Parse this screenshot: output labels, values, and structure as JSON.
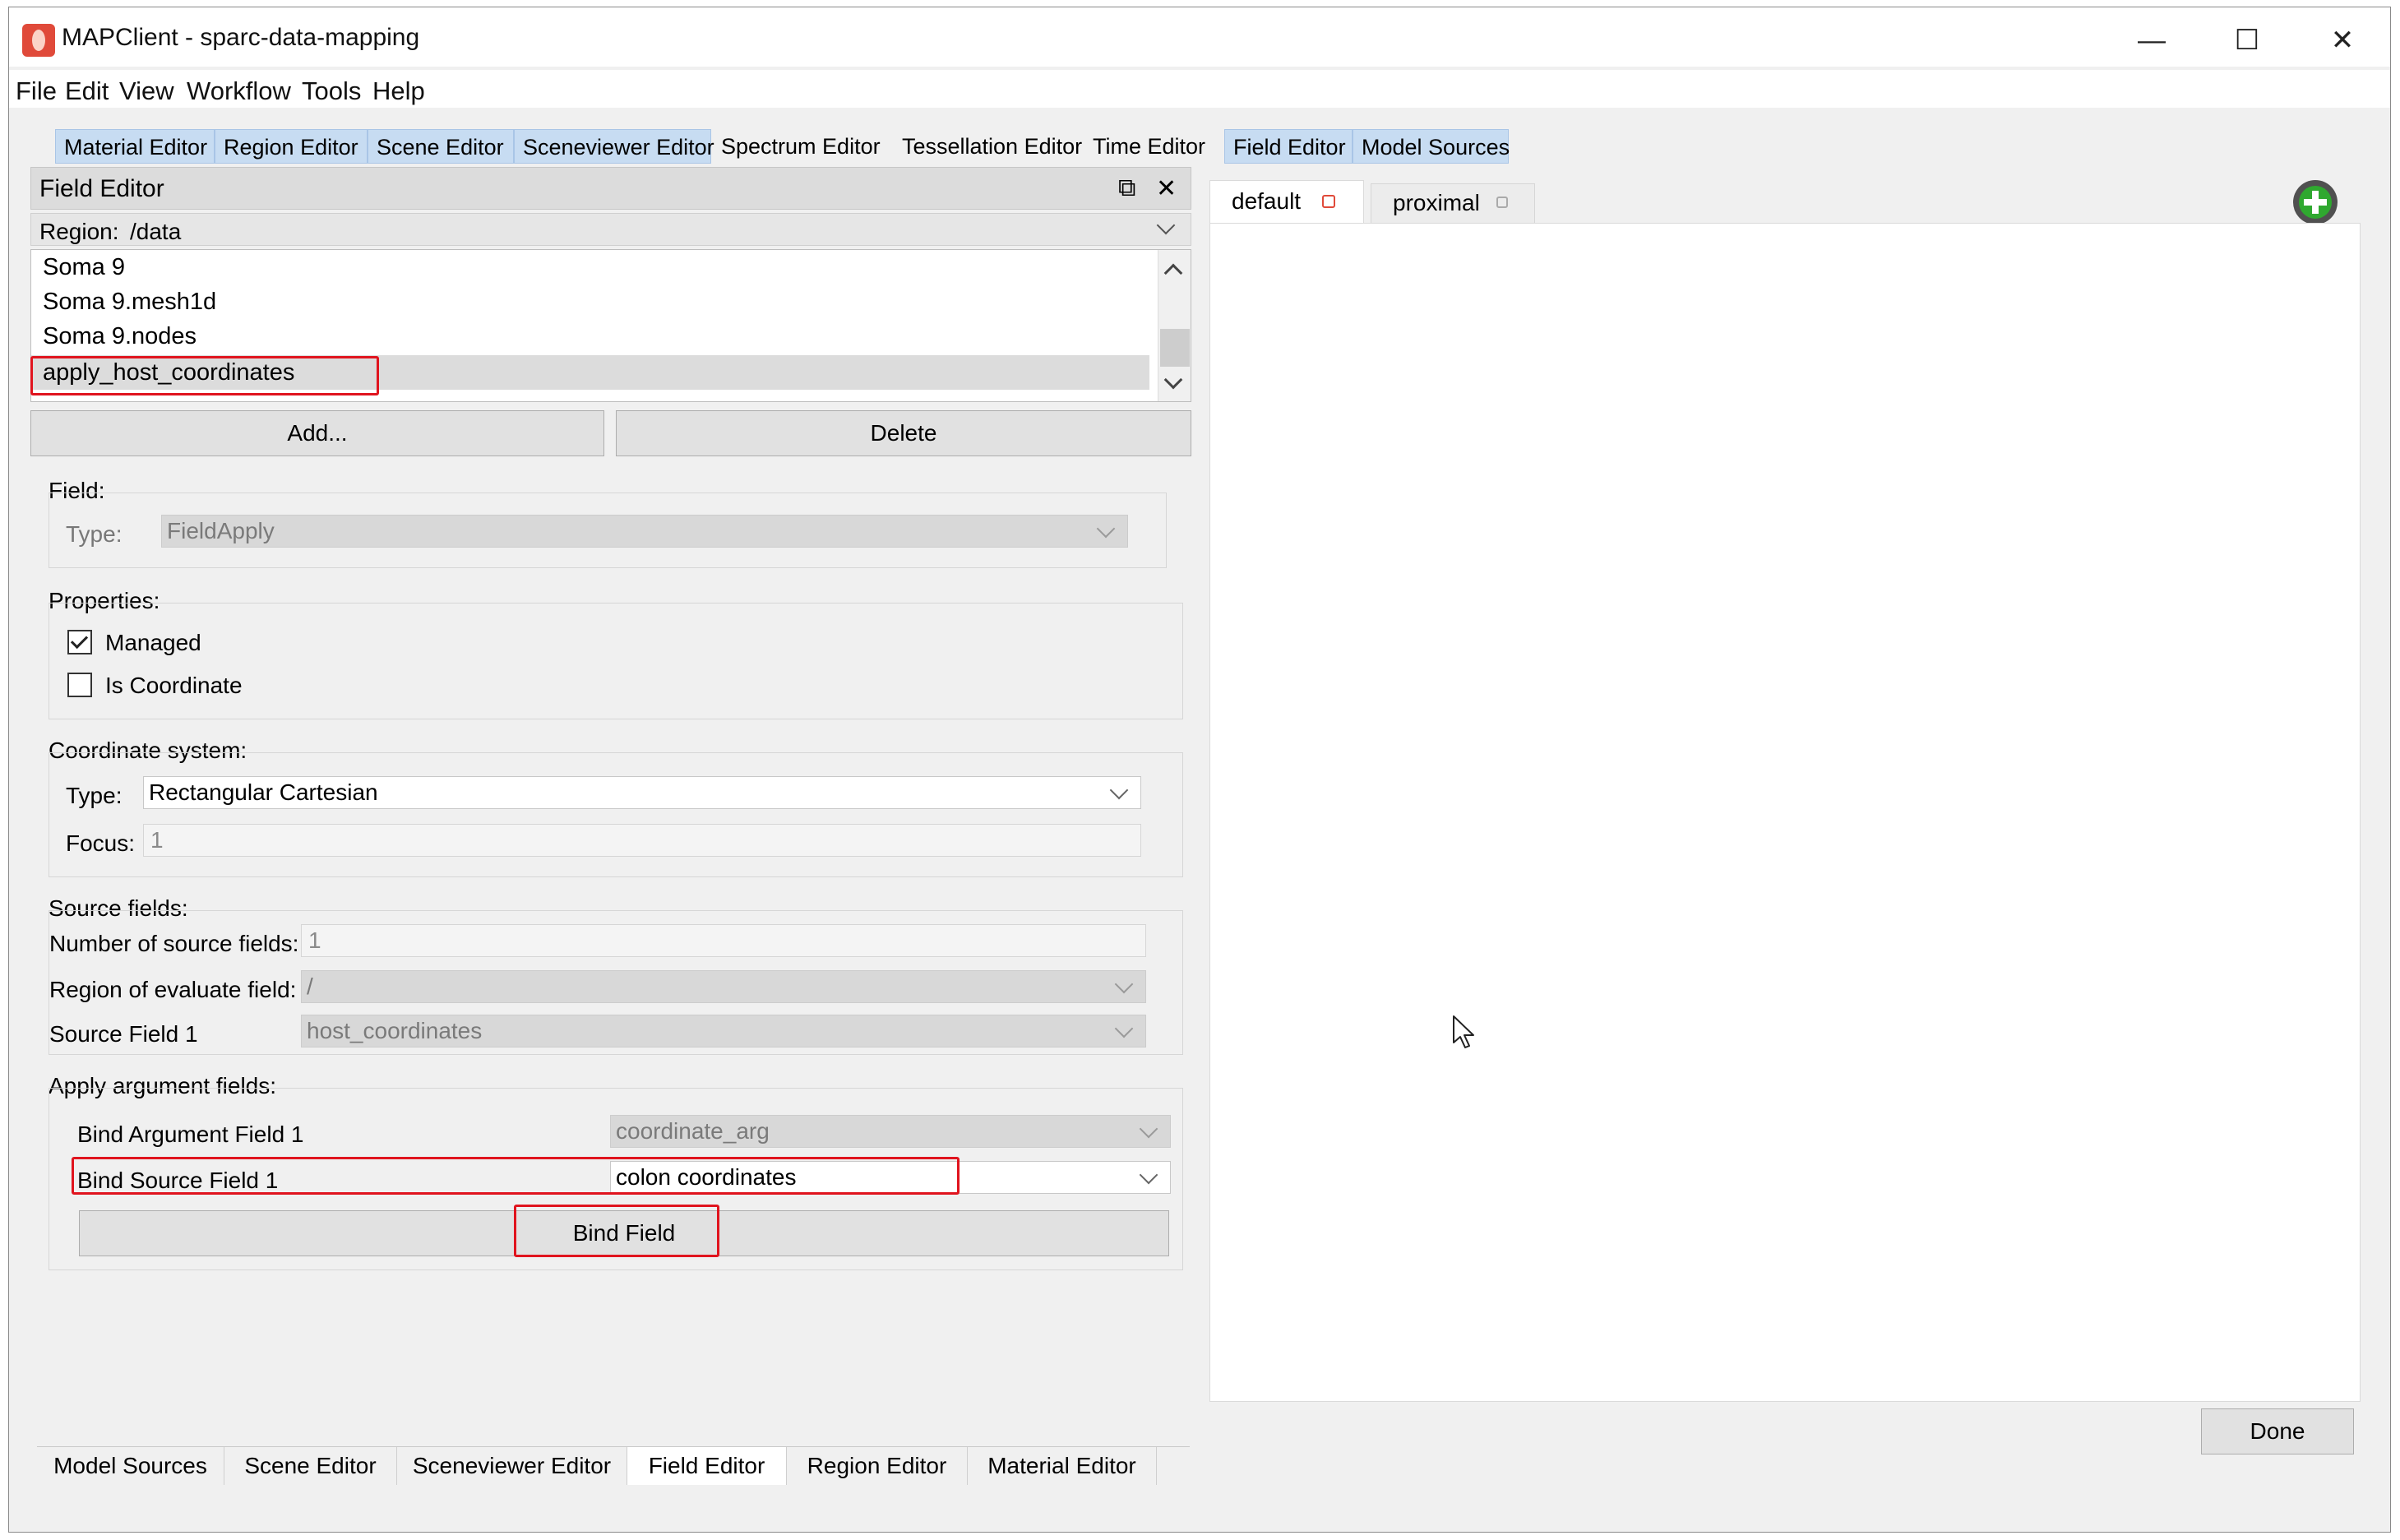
{
  "window": {
    "title": "MAPClient - sparc-data-mapping",
    "minimize_glyph": "—",
    "maximize_glyph": "☐",
    "close_glyph": "✕"
  },
  "menu": [
    "File",
    "Edit",
    "View",
    "Workflow",
    "Tools",
    "Help"
  ],
  "top_tabs": [
    {
      "label": "Material Editor",
      "highlighted": true
    },
    {
      "label": "Region Editor",
      "highlighted": true
    },
    {
      "label": "Scene Editor",
      "highlighted": true
    },
    {
      "label": "Sceneviewer Editor",
      "highlighted": true
    },
    {
      "label": "Spectrum Editor",
      "highlighted": false
    },
    {
      "label": "Tessellation Editor",
      "highlighted": false
    },
    {
      "label": "Time Editor",
      "highlighted": false
    },
    {
      "label": "Field Editor",
      "highlighted": true
    },
    {
      "label": "Model Sources",
      "highlighted": true
    }
  ],
  "field_editor": {
    "dock_title": "Field Editor",
    "region_label": "Region:",
    "region_value": "/data",
    "field_list": [
      "Soma 9",
      "Soma 9.mesh1d",
      "Soma 9.nodes",
      "apply_host_coordinates"
    ],
    "selected_field": "apply_host_coordinates",
    "add_button": "Add...",
    "delete_button": "Delete",
    "field_group": {
      "title": "Field:",
      "type_label": "Type:",
      "type_value": "FieldApply"
    },
    "properties_group": {
      "title": "Properties:",
      "managed_label": "Managed",
      "managed_checked": true,
      "is_coordinate_label": "Is Coordinate",
      "is_coordinate_checked": false
    },
    "coordinate_group": {
      "title": "Coordinate system:",
      "type_label": "Type:",
      "type_value": "Rectangular Cartesian",
      "focus_label": "Focus:",
      "focus_value": "1"
    },
    "source_group": {
      "title": "Source fields:",
      "num_label": "Number of source fields:",
      "num_value": "1",
      "region_label": "Region of evaluate field:",
      "region_value": "/",
      "source1_label": "Source Field 1",
      "source1_value": "host_coordinates"
    },
    "apply_group": {
      "title": "Apply argument fields:",
      "bind_arg_label": "Bind Argument Field 1",
      "bind_arg_value": "coordinate_arg",
      "bind_source_label": "Bind Source Field 1",
      "bind_source_value": "colon coordinates",
      "bind_button": "Bind Field"
    }
  },
  "bottom_tabs": [
    {
      "label": "Model Sources",
      "active": false
    },
    {
      "label": "Scene Editor",
      "active": false
    },
    {
      "label": "Sceneviewer Editor",
      "active": false
    },
    {
      "label": "Field Editor",
      "active": true
    },
    {
      "label": "Region Editor",
      "active": false
    },
    {
      "label": "Material Editor",
      "active": false
    }
  ],
  "scene_tabs": [
    {
      "label": "default",
      "active": true
    },
    {
      "label": "proximal",
      "active": false
    }
  ],
  "done_button": "Done",
  "colors": {
    "highlight_tab": "#c7dcf2",
    "annotation_red": "#e0141e",
    "add_icon_green": "#2fa82f"
  }
}
